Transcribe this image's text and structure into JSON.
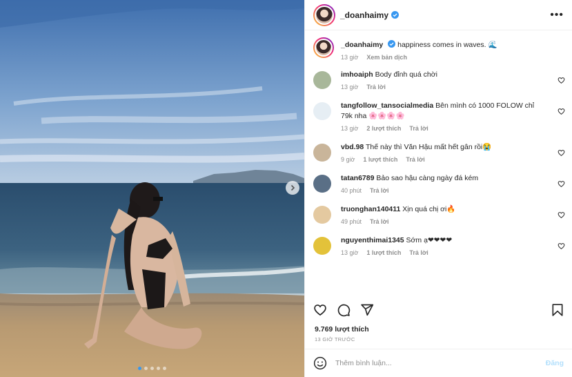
{
  "post": {
    "author": "_doanhaimy",
    "caption": "happiness comes in waves. 🌊",
    "caption_time": "13 giờ",
    "translate_label": "Xem bản dịch",
    "likes": "9.769 lượt thích",
    "posted_ago": "13 GIỜ TRƯỚC",
    "carousel": {
      "count": 5,
      "active_index": 0
    }
  },
  "comments": [
    {
      "user": "imhoaiph",
      "text": "Body đỉnh quá chời",
      "time": "13 giờ",
      "likes": "",
      "reply": "Trả lời",
      "avatar_color": "#a8b79a"
    },
    {
      "user": "tangfollow_tansocialmedia",
      "text": "Bên mình có 1000 FOLOW chỉ 79k nha 🌸🌸🌸🌸",
      "time": "13 giờ",
      "likes": "2 lượt thích",
      "reply": "Trả lời",
      "avatar_color": "#e6eef4"
    },
    {
      "user": "vbd.98",
      "text": "Thế này thì Văn Hậu mất hết gân rồi😭",
      "time": "9 giờ",
      "likes": "1 lượt thích",
      "reply": "Trả lời",
      "avatar_color": "#c9b59a"
    },
    {
      "user": "tatan6789",
      "text": "Bảo sao hậu càng ngày đá kém",
      "time": "40 phút",
      "likes": "",
      "reply": "Trả lời",
      "avatar_color": "#5a6f86"
    },
    {
      "user": "truonghan140411",
      "text": "Xịn quá chị ơi🔥",
      "time": "49 phút",
      "likes": "",
      "reply": "Trả lời",
      "avatar_color": "#e4c9a0"
    },
    {
      "user": "nguyenthimai1345",
      "text": "Sớm ạ❤❤❤❤",
      "time": "13 giờ",
      "likes": "1 lượt thích",
      "reply": "Trả lời",
      "avatar_color": "#e3c23a"
    }
  ],
  "add_comment": {
    "placeholder": "Thêm bình luận...",
    "post_label": "Đăng"
  },
  "icons": {
    "verified": "verified-badge-icon",
    "more": "more-options-icon",
    "like": "heart-icon",
    "comment": "comment-icon",
    "share": "share-icon",
    "save": "bookmark-icon",
    "emoji": "emoji-icon",
    "next": "chevron-right-icon"
  },
  "colors": {
    "accent": "#3797f0",
    "post_disabled": "#b2dffc",
    "muted": "#8e8e8e"
  }
}
